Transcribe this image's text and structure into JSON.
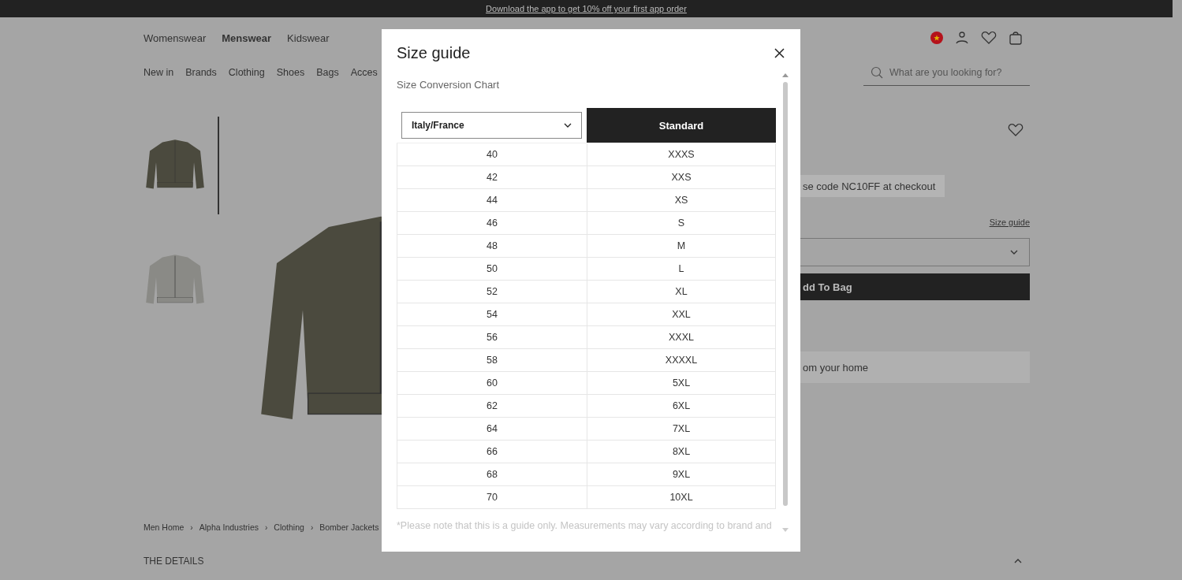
{
  "promo_banner": {
    "text": "Download the app to get 10% off your first app order"
  },
  "top_nav": [
    {
      "label": "Womenswear",
      "selected": false
    },
    {
      "label": "Menswear",
      "selected": true
    },
    {
      "label": "Kidswear",
      "selected": false
    }
  ],
  "category_nav": [
    "New in",
    "Brands",
    "Clothing",
    "Shoes",
    "Bags",
    "Acces"
  ],
  "search": {
    "placeholder": "What are you looking for?"
  },
  "thumbnails": [
    {
      "kind": "front",
      "selected": true
    },
    {
      "kind": "back",
      "selected": false
    }
  ],
  "product_panel": {
    "promo": "se code NC10FF at checkout",
    "size_guide_link": "Size guide",
    "add_button": "dd To Bag",
    "home_note": "om your home"
  },
  "breadcrumbs": [
    "Men Home",
    "Alpha Industries",
    "Clothing",
    "Bomber Jackets"
  ],
  "breadcrumb_separator": "›",
  "details_heading": {
    "label": "THE DETAILS",
    "expanded": true
  },
  "size_guide": {
    "title": "Size guide",
    "subtitle": "Size Conversion Chart",
    "region_select": "Italy/France",
    "standard_heading": "Standard",
    "rows": [
      [
        "40",
        "XXXS"
      ],
      [
        "42",
        "XXS"
      ],
      [
        "44",
        "XS"
      ],
      [
        "46",
        "S"
      ],
      [
        "48",
        "M"
      ],
      [
        "50",
        "L"
      ],
      [
        "52",
        "XL"
      ],
      [
        "54",
        "XXL"
      ],
      [
        "56",
        "XXXL"
      ],
      [
        "58",
        "XXXXL"
      ],
      [
        "60",
        "5XL"
      ],
      [
        "62",
        "6XL"
      ],
      [
        "64",
        "7XL"
      ],
      [
        "66",
        "8XL"
      ],
      [
        "68",
        "9XL"
      ],
      [
        "70",
        "10XL"
      ]
    ],
    "note": "*Please note that this is a guide only. Measurements may vary according to brand and"
  }
}
